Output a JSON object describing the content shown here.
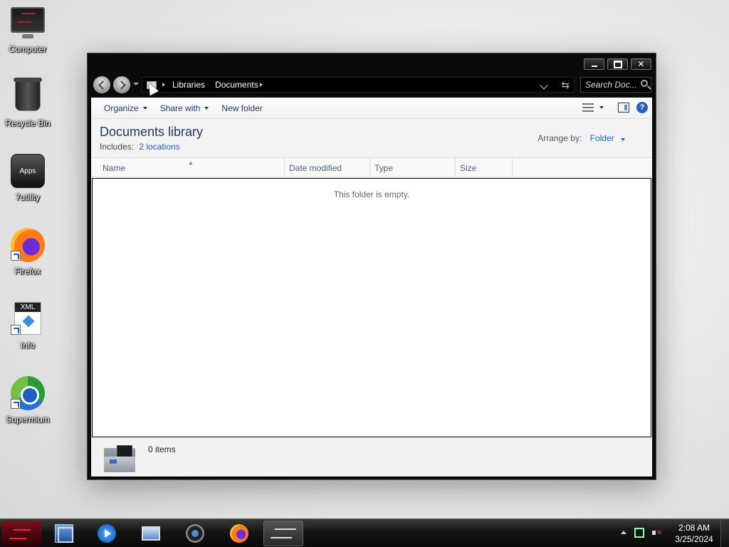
{
  "desktop": {
    "icons": [
      {
        "label": "Computer",
        "icon": "computer-icon"
      },
      {
        "label": "Recycle Bin",
        "icon": "recycle-bin-icon"
      },
      {
        "label": "7utility",
        "icon": "apps-icon",
        "badge": "Apps"
      },
      {
        "label": "Firefox",
        "icon": "firefox-icon"
      },
      {
        "label": "Info",
        "icon": "xml-file-icon",
        "badge": "XML"
      },
      {
        "label": "Supermium",
        "icon": "supermium-icon"
      }
    ]
  },
  "window": {
    "caption_buttons": {
      "minimize": "minimize",
      "maximize": "maximize",
      "close": "✕"
    },
    "breadcrumb": [
      "Libraries",
      "Documents"
    ],
    "search_placeholder": "Search Doc...",
    "toolbar": {
      "organize": "Organize",
      "share_with": "Share with",
      "new_folder": "New folder"
    },
    "library": {
      "title": "Documents library",
      "includes_label": "Includes:",
      "includes_link": "2 locations",
      "arrange_label": "Arrange by:",
      "arrange_value": "Folder"
    },
    "columns": [
      "Name",
      "Date modified",
      "Type",
      "Size"
    ],
    "empty_message": "This folder is empty.",
    "details": {
      "count": "0 items"
    }
  },
  "taskbar": {
    "buttons": [
      "start",
      "explorer",
      "media-player",
      "monitor",
      "camera",
      "firefox",
      "rog"
    ],
    "clock": {
      "time": "2:08 AM",
      "date": "3/25/2024"
    }
  },
  "colors": {
    "accent": "#1a62c7",
    "title_text": "#1e395b",
    "close_mute": "#e33"
  }
}
